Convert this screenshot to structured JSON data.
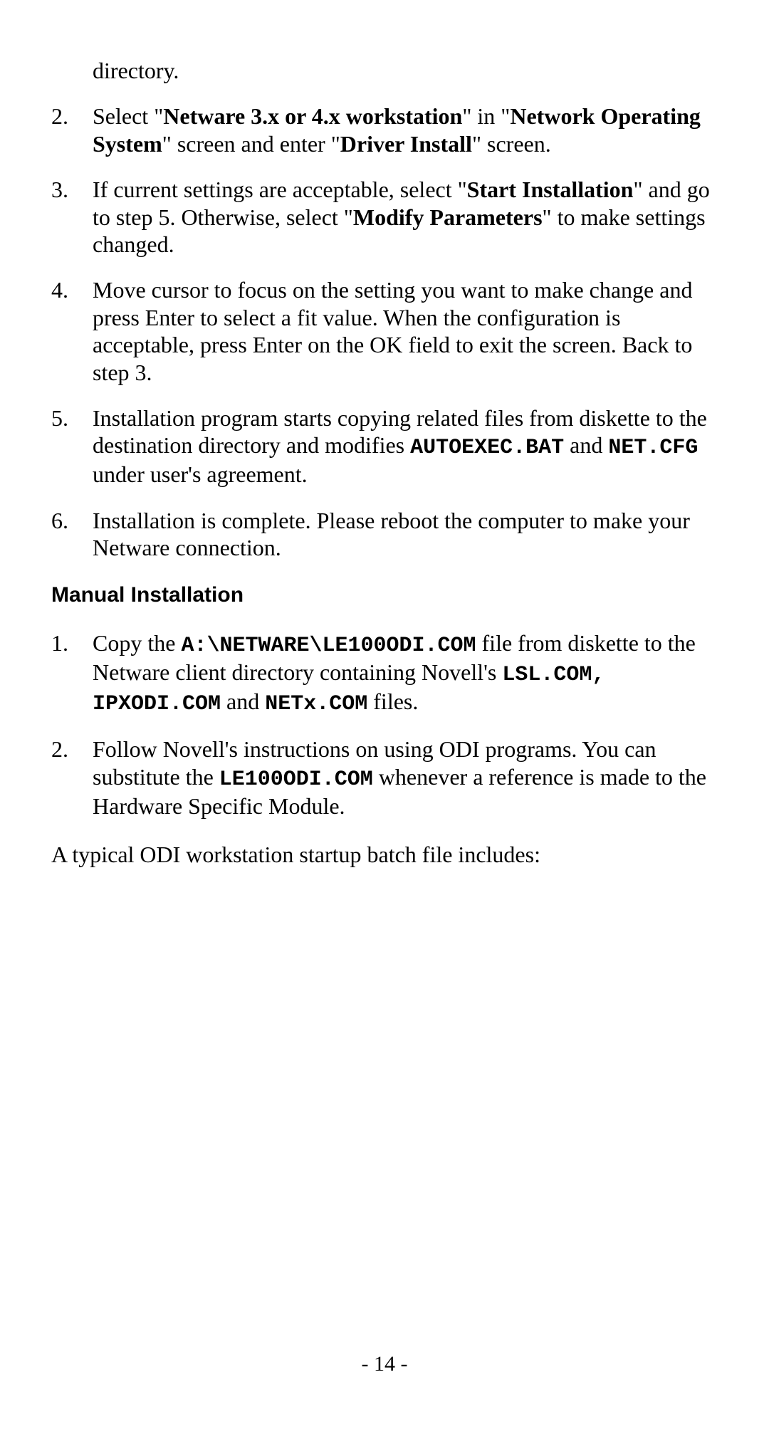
{
  "continuation1": "directory.",
  "step2_num": "2.",
  "step2_text_a": "Select \"",
  "step2_bold_a": "Netware 3.x or 4.x workstation",
  "step2_text_b": "\" in \"",
  "step2_bold_b": "Network Operating System",
  "step2_text_c": "\" screen and enter \"",
  "step2_bold_c": "Driver Install",
  "step2_text_d": "\" screen.",
  "step3_num": "3.",
  "step3_text_a": "If current settings are acceptable, select \"",
  "step3_bold_a": "Start Installation",
  "step3_text_b": "\" and go to step 5. Otherwise, select \"",
  "step3_bold_b": "Modify Parameters",
  "step3_text_c": "\" to make settings changed.",
  "step4_num": "4.",
  "step4_text": "Move cursor to focus on the setting you want to make change and press Enter to select a fit value.  When the configuration is acceptable, press Enter on the OK field to exit the screen. Back to step 3.",
  "step5_num": "5.",
  "step5_text_a": "Installation program starts copying related files from diskette to the destination directory and modifies ",
  "step5_mono_a": "AUTOEXEC.BAT",
  "step5_text_b": " and ",
  "step5_mono_b": "NET.CFG",
  "step5_text_c": " under user's agreement.",
  "step6_num": "6.",
  "step6_text": "Installation is complete.  Please reboot the computer to make your Netware connection.",
  "heading": "Manual Installation",
  "m1_num": "1.",
  "m1_text_a": "Copy the ",
  "m1_mono_a": "A:\\NETWARE\\LE100ODI.COM",
  "m1_text_b": " file  from diskette to the Netware client directory containing Novell's ",
  "m1_mono_b": "LSL.COM, IPXODI.COM",
  "m1_text_c": " and ",
  "m1_mono_c": "NETx.COM",
  "m1_text_d": " files.",
  "m2_num": "2.",
  "m2_text_a": "Follow Novell's instructions on using ODI programs. You can substitute the ",
  "m2_mono_a": "LE100ODI.COM",
  "m2_text_b": " whenever a reference is made to the Hardware Specific Module.",
  "closing": "A typical ODI workstation startup batch file includes:",
  "page": "- 14 -"
}
